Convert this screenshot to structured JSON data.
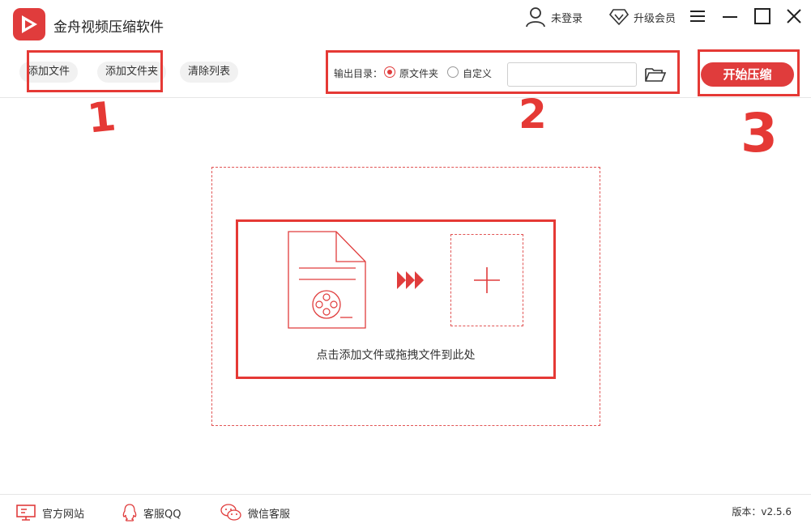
{
  "app": {
    "title": "金舟视频压缩软件"
  },
  "header": {
    "login_label": "未登录",
    "vip_label": "升级会员"
  },
  "toolbar": {
    "add_file": "添加文件",
    "add_folder": "添加文件夹",
    "clear_list": "清除列表",
    "output_label": "输出目录：",
    "option_original": "原文件夹",
    "option_custom": "自定义",
    "path_value": "",
    "start_label": "开始压缩"
  },
  "dropzone": {
    "hint": "点击添加文件或拖拽文件到此处"
  },
  "annotations": [
    "1",
    "2",
    "3"
  ],
  "footer": {
    "website": "官方网站",
    "qq": "客服QQ",
    "wechat": "微信客服",
    "version": "版本：v2.5.6"
  },
  "colors": {
    "accent": "#e03c3c",
    "annotation": "#e53935"
  }
}
